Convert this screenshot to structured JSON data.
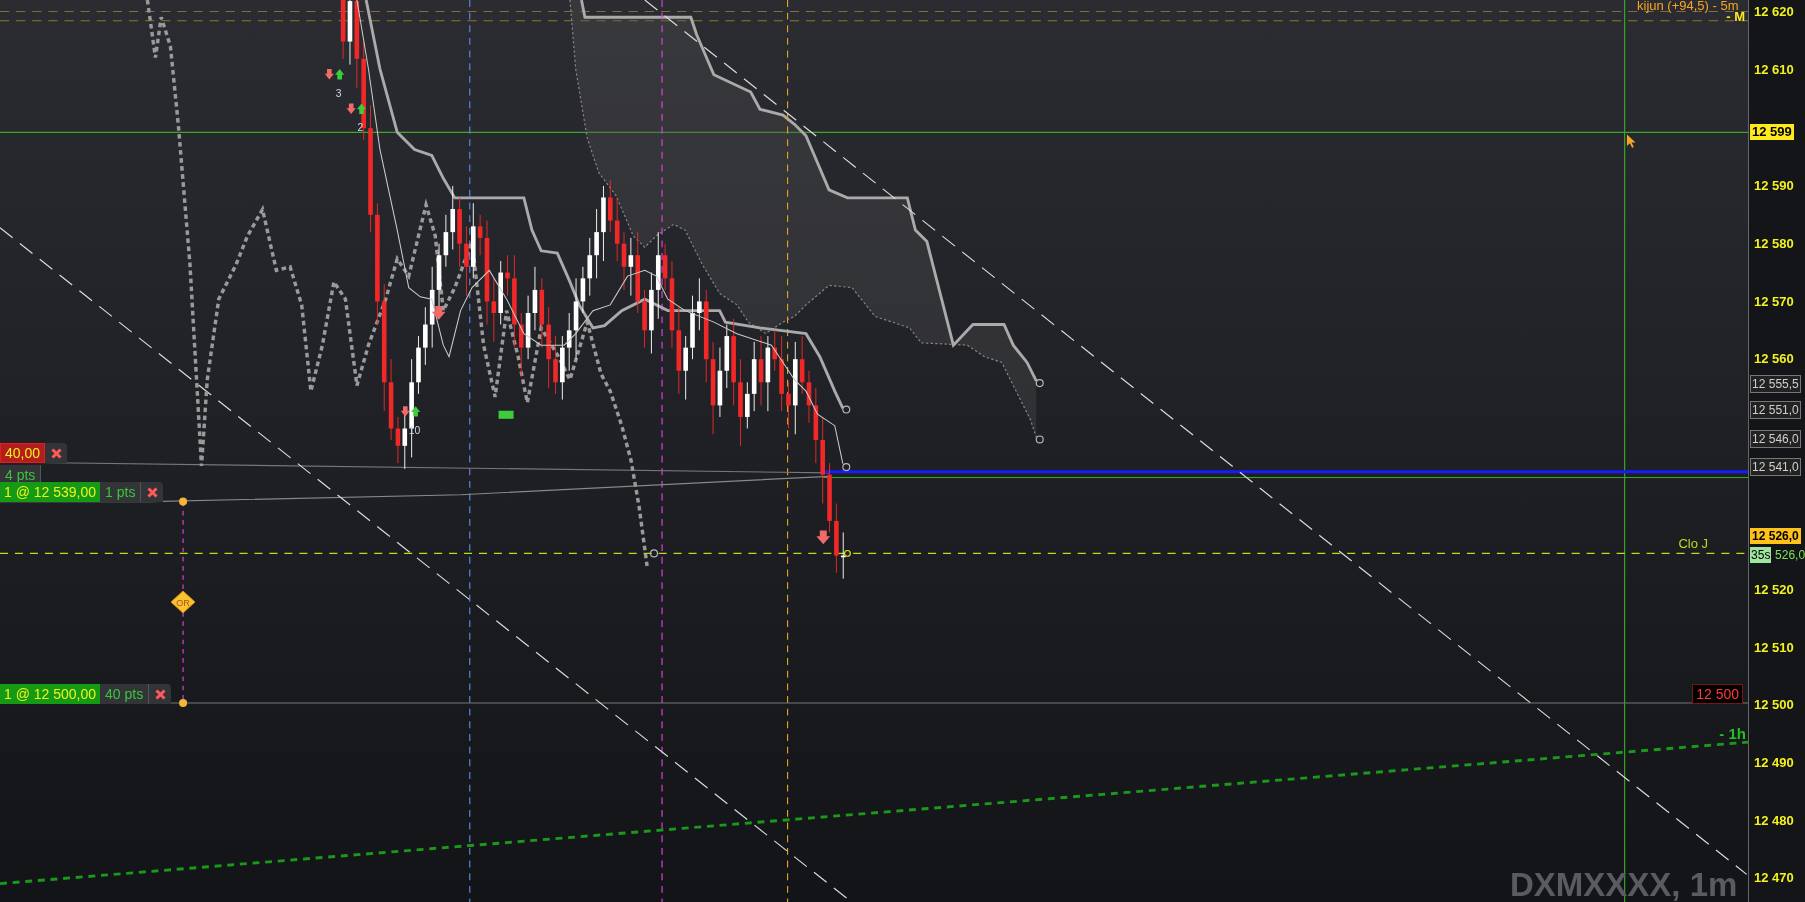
{
  "chart": {
    "kijun_label": "kijun (+94,5) - 5m",
    "monthly_label": "- M",
    "close_label": "Clo J",
    "hourly_label": "- 1h",
    "level_tag": "12 500",
    "alert_marker": "OR",
    "symbol": "DXMXXXX, 1m",
    "signal_counts": [
      "3",
      "2",
      "10"
    ]
  },
  "orders": [
    {
      "kind": "sell",
      "price": "40,00"
    },
    {
      "kind": "pts",
      "points": "4 pts"
    },
    {
      "kind": "buy",
      "price": "1 @ 12 539,00",
      "points": "1 pts"
    },
    {
      "kind": "buy",
      "price": "1 @ 12 500,00",
      "points": "40 pts"
    }
  ],
  "price_axis": [
    {
      "kind": "tick",
      "label": "12 620"
    },
    {
      "kind": "tick",
      "label": "12 610"
    },
    {
      "kind": "crosshair",
      "label": "12 599"
    },
    {
      "kind": "tick",
      "label": "12 590"
    },
    {
      "kind": "tick",
      "label": "12 580"
    },
    {
      "kind": "tick",
      "label": "12 570"
    },
    {
      "kind": "tick",
      "label": "12 560"
    },
    {
      "kind": "level",
      "label": "12 555,5"
    },
    {
      "kind": "level",
      "label": "12 551,0"
    },
    {
      "kind": "level",
      "label": "12 546,0"
    },
    {
      "kind": "level",
      "label": "12 541,0"
    },
    {
      "kind": "price",
      "label": "12 526,0"
    },
    {
      "kind": "timer",
      "label": "35s"
    },
    {
      "kind": "last",
      "label": "526,0"
    },
    {
      "kind": "tick",
      "label": "12 520"
    },
    {
      "kind": "tick",
      "label": "12 510"
    },
    {
      "kind": "tick",
      "label": "12 500"
    },
    {
      "kind": "tick",
      "label": "12 490"
    },
    {
      "kind": "tick",
      "label": "12 480"
    },
    {
      "kind": "tick",
      "label": "12 470"
    }
  ]
}
